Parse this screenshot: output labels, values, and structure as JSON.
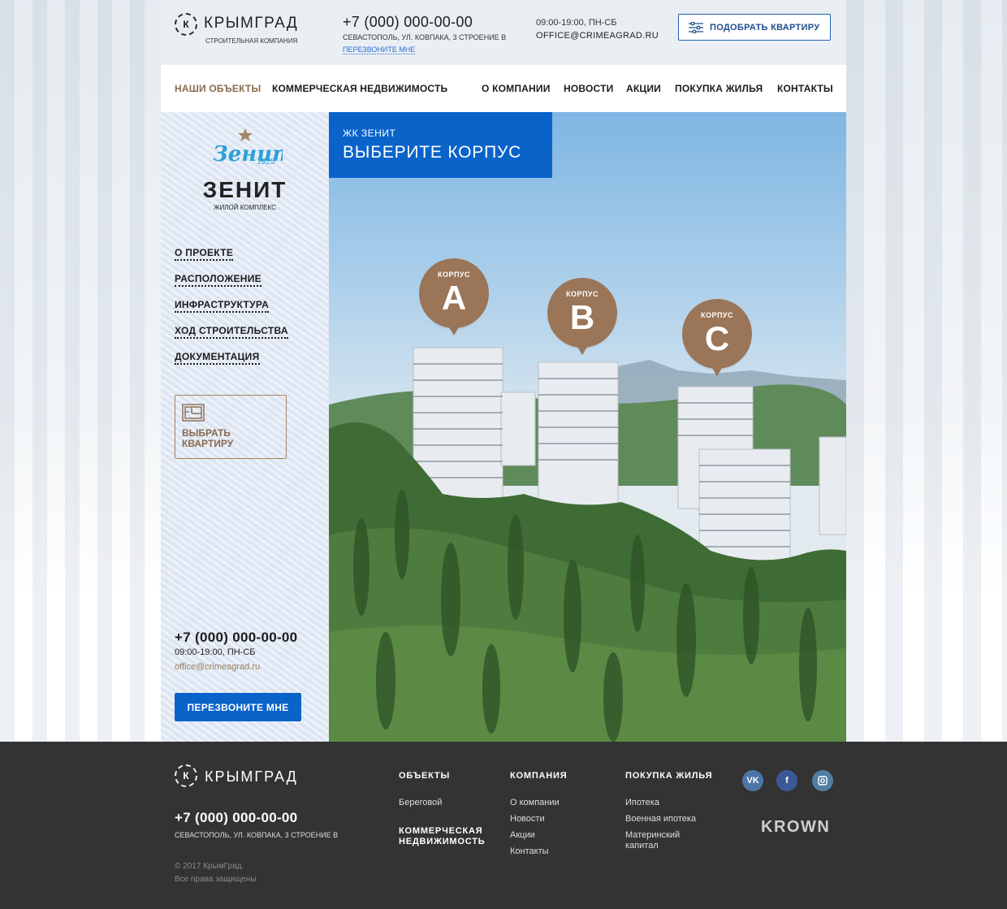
{
  "header": {
    "logo_letter": "К",
    "logo_name": "КРЫМГРАД",
    "logo_sub": "СТРОИТЕЛЬНАЯ КОМПАНИЯ",
    "phone": "+7 (000) 000-00-00",
    "address": "СЕВАСТОПОЛЬ, УЛ. КОВПАКА, 3 СТРОЕНИЕ В",
    "callback": "ПЕРЕЗВОНИТЕ МНЕ",
    "hours": "09:00-19:00, ПН-СБ",
    "email": "OFFICE@CRIMEAGRAD.RU",
    "pick_button": "ПОДОБРАТЬ КВАРТИРУ"
  },
  "nav": {
    "items": [
      {
        "label": "НАШИ ОБЪЕКТЫ",
        "active": true
      },
      {
        "label": "КОММЕРЧЕСКАЯ НЕДВИЖИМОСТЬ"
      },
      {
        "label": "О КОМПАНИИ"
      },
      {
        "label": "НОВОСТИ"
      },
      {
        "label": "АКЦИИ"
      },
      {
        "label": "ПОКУПКА ЖИЛЬЯ"
      },
      {
        "label": "КОНТАКТЫ"
      }
    ]
  },
  "sidebar": {
    "emblem_year": "1925",
    "emblem_word": "Зенит",
    "title": "ЗЕНИТ",
    "subtitle": "ЖИЛОЙ КОМПЛЕКС",
    "menu": [
      "О ПРОЕКТЕ",
      "РАСПОЛОЖЕНИЕ",
      "ИНФРАСТРУКТУРА",
      "ХОД СТРОИТЕЛЬСТВА",
      "ДОКУМЕНТАЦИЯ"
    ],
    "choose_label": "ВЫБРАТЬ КВАРТИРУ",
    "phone": "+7 (000) 000-00-00",
    "hours": "09:00-19:00, ПН-СБ",
    "email": "office@crimeagrad.ru",
    "callback": "ПЕРЕЗВОНИТЕ МНЕ"
  },
  "hero": {
    "eyebrow": "ЖК ЗЕНИТ",
    "title": "ВЫБЕРИТЕ КОРПУС",
    "pins": [
      {
        "label": "КОРПУС",
        "value": "A"
      },
      {
        "label": "КОРПУС",
        "value": "B"
      },
      {
        "label": "КОРПУС",
        "value": "C"
      }
    ]
  },
  "footer": {
    "logo_letter": "К",
    "logo_name": "КРЫМГРАД",
    "phone": "+7 (000) 000-00-00",
    "address": "СЕВАСТОПОЛЬ, УЛ. КОВПАКА, 3 СТРОЕНИЕ В",
    "copyright_1": "© 2017 КрымГрад.",
    "copyright_2": "Все права защищены",
    "col_objects": {
      "heading": "ОБЪЕКТЫ",
      "links": [
        "Береговой"
      ],
      "heading2": "КОММЕРЧЕСКАЯ НЕДВИЖИМОСТЬ"
    },
    "col_company": {
      "heading": "КОМПАНИЯ",
      "links": [
        "О компании",
        "Новости",
        "Акции",
        "Контакты"
      ]
    },
    "col_buying": {
      "heading": "ПОКУПКА ЖИЛЬЯ",
      "links": [
        "Ипотека",
        "Военная ипотека",
        "Материнский капитал"
      ]
    },
    "social": [
      "vk-icon",
      "facebook-icon",
      "instagram-icon"
    ],
    "partner": "KROWN"
  },
  "colors": {
    "accent_blue": "#0a63c9",
    "brown": "#9a7558",
    "footer_bg": "#333333"
  }
}
